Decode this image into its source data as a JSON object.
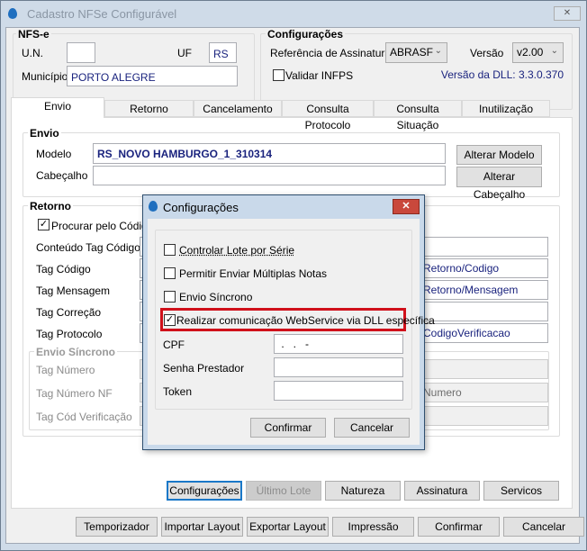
{
  "window": {
    "title": "Cadastro NFSe Configurável",
    "close": "✕"
  },
  "nfse": {
    "title": "NFS-e",
    "un_label": "U.N.",
    "un_value": "",
    "uf_label": "UF",
    "uf_value": "RS",
    "municipio_label": "Município",
    "municipio_value": "PORTO ALEGRE"
  },
  "config": {
    "title": "Configurações",
    "ref_label": "Referência de Assinatura",
    "ref_value": "ABRASF",
    "versao_label": "Versão",
    "versao_value": "v2.00",
    "validar_label": "Validar INFPS",
    "dll_version": "Versão da DLL: 3.3.0.370"
  },
  "tabs": [
    "Envio",
    "Retorno",
    "Cancelamento",
    "Consulta Protocolo",
    "Consulta Situação",
    "Inutilização"
  ],
  "envio": {
    "title": "Envio",
    "modelo_label": "Modelo",
    "modelo_value": "RS_NOVO HAMBURGO_1_310314",
    "cabecalho_label": "Cabeçalho",
    "cabecalho_value": "",
    "alterar_modelo": "Alterar Modelo",
    "alterar_cabecalho": "Alterar Cabeçalho"
  },
  "retorno": {
    "title": "Retorno",
    "procurar_label": "Procurar pelo Código",
    "rows": [
      {
        "label": "Conteúdo Tag Código",
        "value": ""
      },
      {
        "label": "Tag Código",
        "value": "Retorno/Codigo"
      },
      {
        "label": "Tag Mensagem",
        "value": "Retorno/Mensagem"
      },
      {
        "label": "Tag Correção",
        "value": ""
      },
      {
        "label": "Tag Protocolo",
        "value": "CodigoVerificacao"
      }
    ],
    "sincrono_title": "Envio Síncrono",
    "sincrono_rows": [
      {
        "label": "Tag Número",
        "value": ""
      },
      {
        "label": "Tag Número NF",
        "value": "Numero"
      },
      {
        "label": "Tag Cód Verificação",
        "value": ""
      }
    ]
  },
  "action_buttons": [
    "Configurações",
    "Último Lote",
    "Natureza",
    "Assinatura",
    "Servicos"
  ],
  "bottom_buttons": [
    "Temporizador",
    "Importar Layout",
    "Exportar Layout",
    "Impressão",
    "Confirmar",
    "Cancelar"
  ],
  "dialog": {
    "title": "Configurações",
    "close": "✕",
    "checks": [
      {
        "label": "Controlar Lote por Série",
        "checked": false
      },
      {
        "label": "Permitir Enviar Múltiplas Notas",
        "checked": false
      },
      {
        "label": "Envio Síncrono",
        "checked": false
      },
      {
        "label": "Realizar comunicação WebService via DLL específica",
        "checked": true
      }
    ],
    "cpf_label": "CPF",
    "cpf_value": " .   .   -",
    "senha_label": "Senha Prestador",
    "senha_value": "",
    "token_label": "Token",
    "token_value": "",
    "confirmar": "Confirmar",
    "cancelar": "Cancelar",
    "highlight_color": "#d0101a"
  }
}
